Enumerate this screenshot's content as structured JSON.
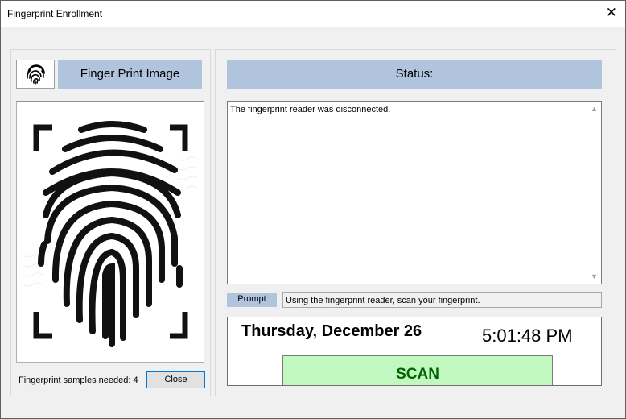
{
  "window": {
    "title": "Fingerprint Enrollment",
    "close_glyph": "✕"
  },
  "left_panel": {
    "thumbnail_icon": "fingerprint-icon",
    "header": "Finger Print Image",
    "image": "fingerprint-image",
    "samples_text": "Fingerprint samples needed: 4",
    "close_button": "Close"
  },
  "right_panel": {
    "header": "Status:",
    "status_message": "The fingerprint reader was disconnected.",
    "scroll_up": "▲",
    "scroll_down": "▼",
    "prompt_label": "Prompt",
    "prompt_text": "Using the fingerprint reader, scan your fingerprint.",
    "date": "Thursday, December 26",
    "time": "5:01:48 PM",
    "scan_button": "SCAN"
  },
  "colors": {
    "header_bg": "#b0c4de",
    "scan_bg": "#c0f8c0",
    "scan_text": "#006400",
    "button_border": "#0078d7"
  }
}
